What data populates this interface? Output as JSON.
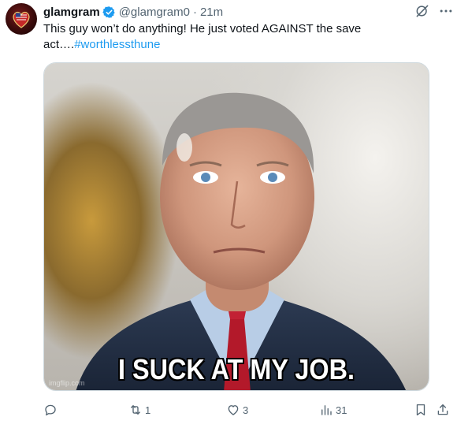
{
  "tweet": {
    "display_name": "glamgram",
    "handle": "@glamgram0",
    "separator": "·",
    "time": "21m",
    "text": "This guy won’t do anything! He just voted AGAINST the save act….",
    "hashtag": "#worthlessthune"
  },
  "media": {
    "caption": "I SUCK AT MY JOB.",
    "watermark": "imgflip.com"
  },
  "actions": {
    "replies": "",
    "retweets": "1",
    "likes": "3",
    "views": "31"
  },
  "colors": {
    "accent": "#1d9bf0",
    "secondary_text": "#536471",
    "primary_text": "#0f1419"
  },
  "icons": {
    "verified": "verified-badge-icon",
    "grok": "grok-icon",
    "more": "more-options-icon",
    "reply": "reply-icon",
    "retweet": "retweet-icon",
    "like": "heart-icon",
    "views": "views-chart-icon",
    "bookmark": "bookmark-icon",
    "share": "share-icon"
  }
}
